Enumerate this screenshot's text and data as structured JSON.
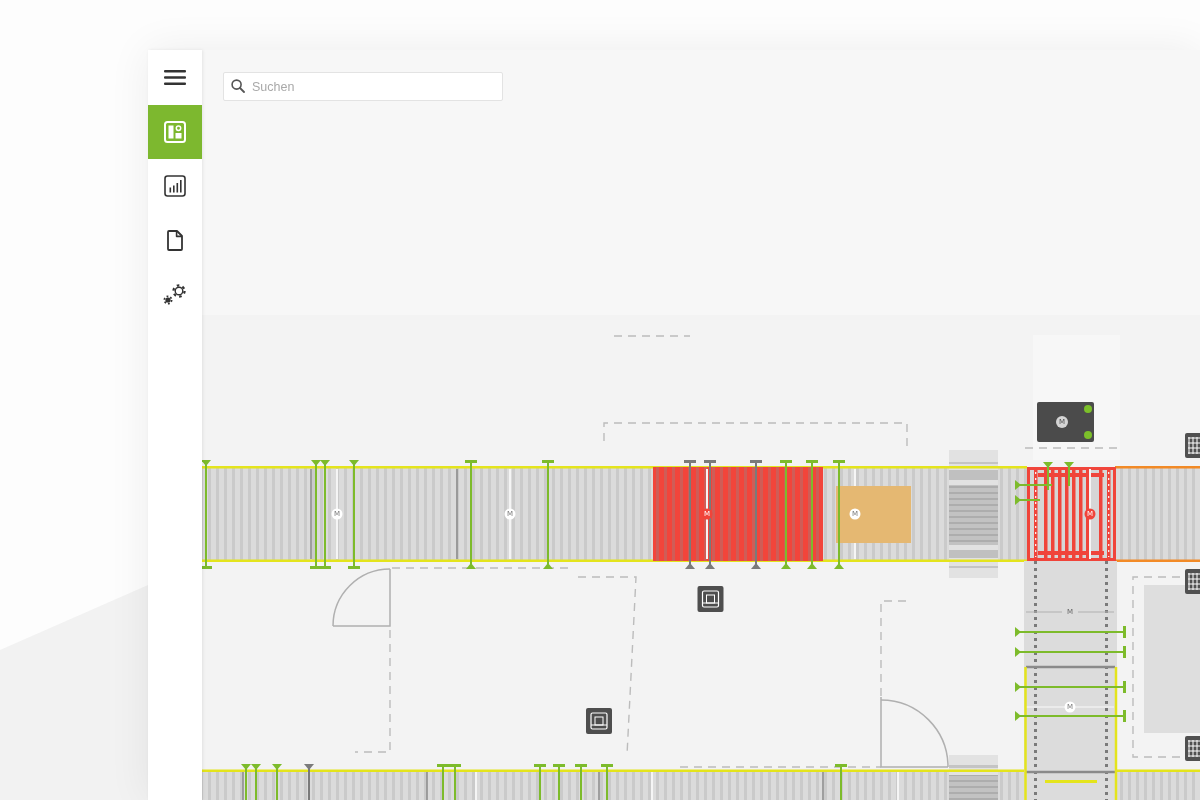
{
  "sidebar": {
    "items": [
      {
        "selected": true
      },
      {
        "selected": false
      },
      {
        "selected": false
      },
      {
        "selected": false
      }
    ]
  },
  "search": {
    "placeholder": "Suchen"
  },
  "floor_plan": {
    "motors": [
      {
        "kind": "box",
        "label": "M",
        "fault": false,
        "lamps": [
          {
            "on": true
          },
          {
            "on": true
          }
        ]
      },
      {
        "kind": "badge",
        "label": "M",
        "fault": false
      },
      {
        "kind": "badge",
        "label": "M",
        "fault": false
      },
      {
        "kind": "badge",
        "label": "M",
        "fault": true
      },
      {
        "kind": "badge",
        "label": "M",
        "fault": false
      },
      {
        "kind": "badge",
        "label": "M",
        "fault": true
      },
      {
        "kind": "plain",
        "label": "M",
        "fault": false
      },
      {
        "kind": "badge",
        "label": "M",
        "fault": false
      }
    ],
    "sensors": [
      {
        "active": true
      },
      {
        "active": true
      },
      {
        "active": true
      },
      {
        "active": true
      },
      {
        "active": true
      },
      {
        "active": true
      },
      {
        "active": false
      },
      {
        "active": false
      },
      {
        "active": false
      },
      {
        "active": true
      },
      {
        "active": true
      },
      {
        "active": true
      },
      {
        "active": true
      },
      {
        "active": true
      },
      {
        "active": true
      },
      {
        "active": true
      },
      {
        "active": true
      },
      {
        "active": true
      },
      {
        "active": true
      },
      {
        "active": true
      },
      {
        "active": true
      },
      {
        "active": true
      },
      {
        "active": true
      },
      {
        "active": false
      },
      {
        "active": true
      },
      {
        "active": true
      },
      {
        "active": true
      },
      {
        "active": true
      },
      {
        "active": true
      },
      {
        "active": true
      },
      {
        "active": true
      }
    ]
  }
}
